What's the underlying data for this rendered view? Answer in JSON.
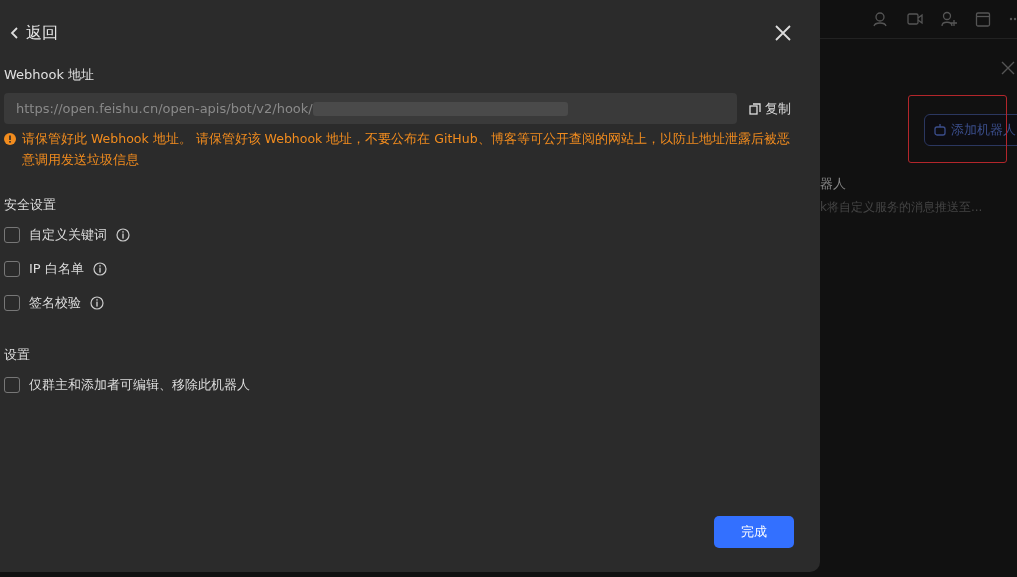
{
  "back_button": {
    "label": "返回"
  },
  "webhook": {
    "label": "Webhook 地址",
    "value": "https://open.feishu.cn/open-apis/bot/v2/hook/",
    "copy_label": "复制",
    "warning": "请保管好此 Webhook 地址。 请保管好该 Webhook 地址，不要公布在 GitHub、博客等可公开查阅的网站上，以防止地址泄露后被恶意调用发送垃圾信息"
  },
  "sections": [
    {
      "title": "安全设置",
      "options": [
        {
          "label": "自定义关键词",
          "checked": false,
          "info": true
        },
        {
          "label": "IP 白名单",
          "checked": false,
          "info": true
        },
        {
          "label": "签名校验",
          "checked": false,
          "info": true
        }
      ]
    },
    {
      "title": "设置",
      "options": [
        {
          "label": "仅群主和添加者可编辑、移除此机器人",
          "checked": false,
          "info": false
        }
      ]
    }
  ],
  "done_button": {
    "label": "完成"
  },
  "background": {
    "add_robot_button": "添加机器人",
    "title": "器人",
    "description": "k将自定义服务的消息推送至..."
  }
}
